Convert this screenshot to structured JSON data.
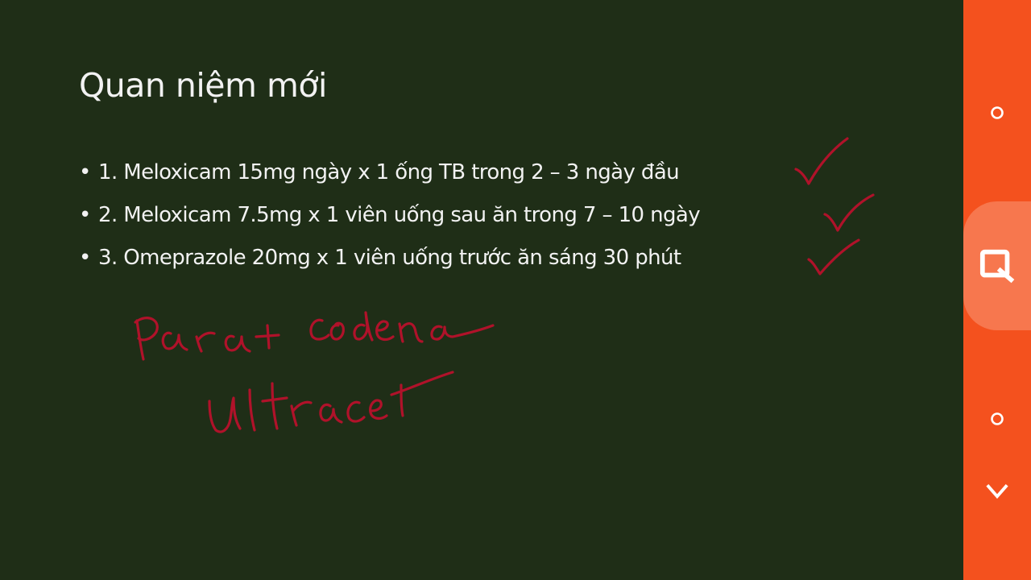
{
  "slide": {
    "title": "Quan niệm mới",
    "bullet_symbol": "•",
    "bullets": [
      "1. Meloxicam 15mg ngày x 1 ống TB trong 2 – 3 ngày đầu",
      "2. Meloxicam 7.5mg x 1 viên uống sau ăn trong 7 – 10 ngày",
      "3. Omeprazole 20mg x 1 viên uống trước ăn sáng 30 phút"
    ],
    "annotations": {
      "handwriting": [
        "Para + codeina",
        "Ultracet"
      ],
      "ink_color": "#b0122a"
    }
  },
  "colors": {
    "slide_background": "#1f2e17",
    "slide_text": "#f2f2f2",
    "sidebar_background": "#f4511e",
    "sidebar_active": "#f7774e"
  },
  "sidebar": {
    "controls": [
      {
        "name": "circle-icon"
      },
      {
        "name": "search-icon"
      },
      {
        "name": "circle-icon"
      },
      {
        "name": "chevron-down-icon"
      }
    ]
  }
}
